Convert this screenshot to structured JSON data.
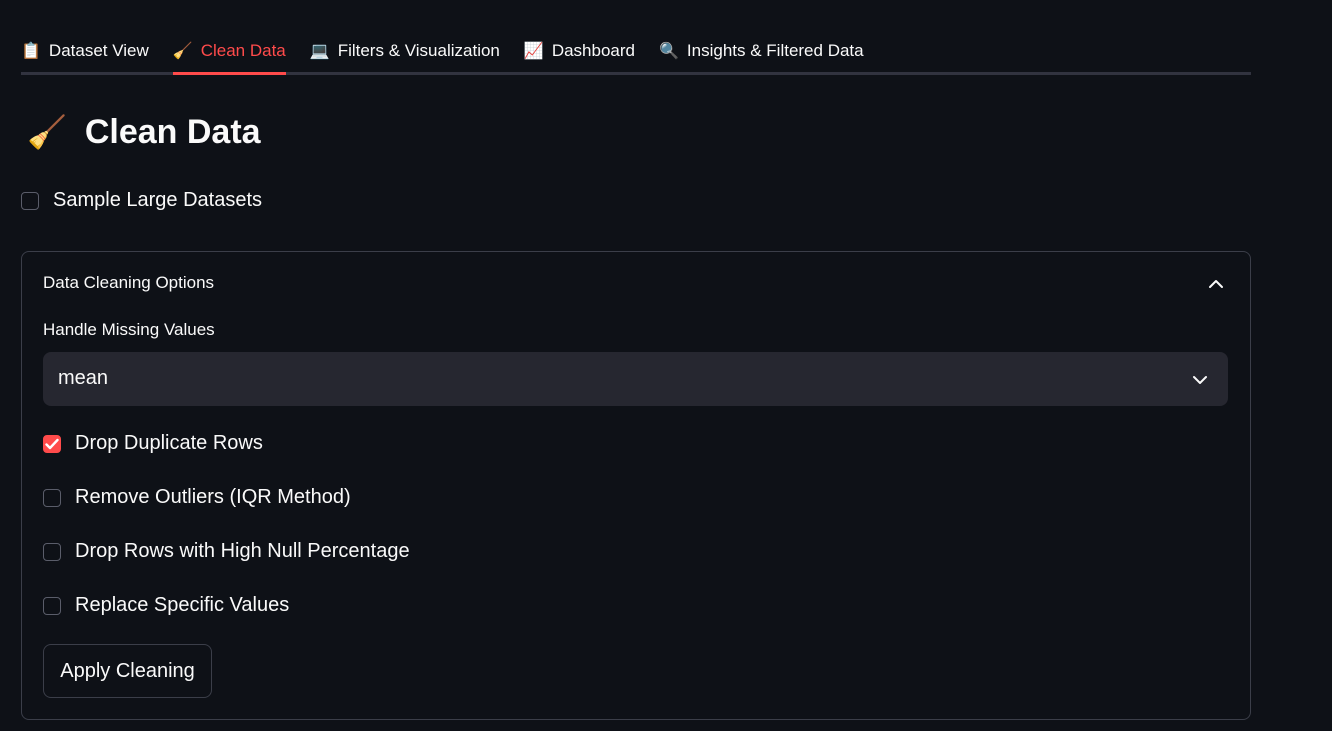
{
  "tabs": [
    {
      "icon": "📋",
      "icon_name": "clipboard-icon",
      "label": "Dataset View"
    },
    {
      "icon": "🧹",
      "icon_name": "broom-icon",
      "label": "Clean Data"
    },
    {
      "icon": "💻",
      "icon_name": "laptop-icon",
      "label": "Filters & Visualization"
    },
    {
      "icon": "📈",
      "icon_name": "chart-icon",
      "label": "Dashboard"
    },
    {
      "icon": "🔍",
      "icon_name": "magnifier-icon",
      "label": "Insights & Filtered Data"
    }
  ],
  "active_tab": "Clean Data",
  "page": {
    "title_icon": "🧹",
    "title": "Clean Data"
  },
  "sample_toggle": {
    "label": "Sample Large Datasets",
    "checked": false
  },
  "expander": {
    "title": "Data Cleaning Options",
    "expanded": true,
    "missing": {
      "label": "Handle Missing Values",
      "value": "mean"
    },
    "options": [
      {
        "label": "Drop Duplicate Rows",
        "checked": true
      },
      {
        "label": "Remove Outliers (IQR Method)",
        "checked": false
      },
      {
        "label": "Drop Rows with High Null Percentage",
        "checked": false
      },
      {
        "label": "Replace Specific Values",
        "checked": false
      }
    ],
    "apply_label": "Apply Cleaning"
  },
  "colors": {
    "accent": "#ff4b4b",
    "background": "#0e1117",
    "input_bg": "#262730",
    "border": "#3b3e49"
  }
}
